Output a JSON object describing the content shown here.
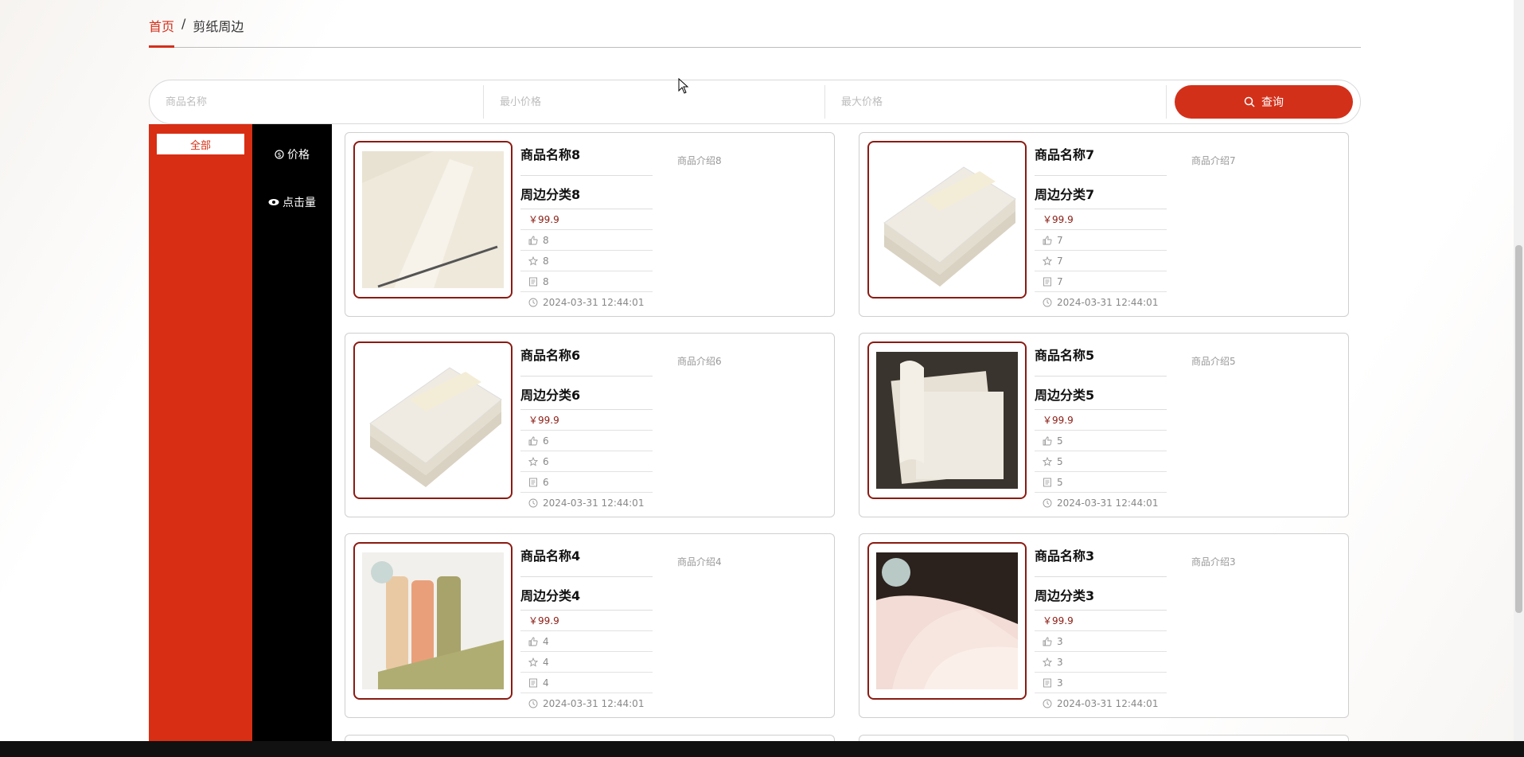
{
  "breadcrumb": {
    "home": "首页",
    "separator": "/",
    "current": "剪纸周边"
  },
  "search": {
    "name_placeholder": "商品名称",
    "min_price_placeholder": "最小价格",
    "max_price_placeholder": "最大价格",
    "button_label": "查询"
  },
  "category": {
    "all_label": "全部"
  },
  "sort": {
    "price_label": "价格",
    "clicks_label": "点击量"
  },
  "colors": {
    "accent": "#d3301a",
    "sidebar_red": "#d82e14",
    "frame": "#8a1b12"
  },
  "products": [
    {
      "name": "商品名称8",
      "category": "周边分类8",
      "price": "￥99.9",
      "likes": "8",
      "favorites": "8",
      "comments": "8",
      "time": "2024-03-31 12:44:01",
      "intro": "商品介绍8",
      "image": "folded-paper-icon"
    },
    {
      "name": "商品名称7",
      "category": "周边分类7",
      "price": "￥99.9",
      "likes": "7",
      "favorites": "7",
      "comments": "7",
      "time": "2024-03-31 12:44:01",
      "intro": "商品介绍7",
      "image": "paper-stack-icon"
    },
    {
      "name": "商品名称6",
      "category": "周边分类6",
      "price": "￥99.9",
      "likes": "6",
      "favorites": "6",
      "comments": "6",
      "time": "2024-03-31 12:44:01",
      "intro": "商品介绍6",
      "image": "paper-stack-icon"
    },
    {
      "name": "商品名称5",
      "category": "周边分类5",
      "price": "￥99.9",
      "likes": "5",
      "favorites": "5",
      "comments": "5",
      "time": "2024-03-31 12:44:01",
      "intro": "商品介绍5",
      "image": "paper-roll-icon"
    },
    {
      "name": "商品名称4",
      "category": "周边分类4",
      "price": "￥99.9",
      "likes": "4",
      "favorites": "4",
      "comments": "4",
      "time": "2024-03-31 12:44:01",
      "intro": "商品介绍4",
      "image": "colored-rolls-icon"
    },
    {
      "name": "商品名称3",
      "category": "周边分类3",
      "price": "￥99.9",
      "likes": "3",
      "favorites": "3",
      "comments": "3",
      "time": "2024-03-31 12:44:01",
      "intro": "商品介绍3",
      "image": "pink-paper-icon"
    }
  ]
}
